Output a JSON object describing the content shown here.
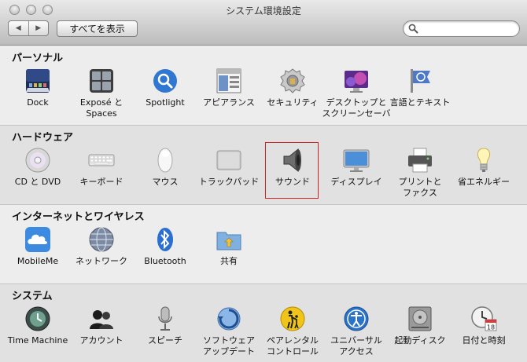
{
  "window": {
    "title": "システム環境設定"
  },
  "toolbar": {
    "back": "◀",
    "forward": "▶",
    "show_all": "すべてを表示"
  },
  "search": {
    "value": ""
  },
  "sections": [
    {
      "title": "パーソナル",
      "items": [
        {
          "label": "Dock",
          "icon": "dock-icon"
        },
        {
          "label": "Exposé と\nSpaces",
          "icon": "expose-spaces-icon"
        },
        {
          "label": "Spotlight",
          "icon": "spotlight-icon"
        },
        {
          "label": "アピアランス",
          "icon": "appearance-icon"
        },
        {
          "label": "セキュリティ",
          "icon": "security-icon"
        },
        {
          "label": "デスクトップと\nスクリーンセーバ",
          "icon": "desktop-screensaver-icon"
        },
        {
          "label": "言語とテキスト",
          "icon": "language-text-icon"
        }
      ]
    },
    {
      "title": "ハードウェア",
      "items": [
        {
          "label": "CD と DVD",
          "icon": "cd-dvd-icon"
        },
        {
          "label": "キーボード",
          "icon": "keyboard-icon"
        },
        {
          "label": "マウス",
          "icon": "mouse-icon"
        },
        {
          "label": "トラックパッド",
          "icon": "trackpad-icon"
        },
        {
          "label": "サウンド",
          "icon": "sound-icon",
          "selected": true
        },
        {
          "label": "ディスプレイ",
          "icon": "display-icon"
        },
        {
          "label": "プリントと\nファクス",
          "icon": "print-fax-icon"
        },
        {
          "label": "省エネルギー",
          "icon": "energy-saver-icon"
        }
      ]
    },
    {
      "title": "インターネットとワイヤレス",
      "items": [
        {
          "label": "MobileMe",
          "icon": "mobileme-icon"
        },
        {
          "label": "ネットワーク",
          "icon": "network-icon"
        },
        {
          "label": "Bluetooth",
          "icon": "bluetooth-icon"
        },
        {
          "label": "共有",
          "icon": "sharing-icon"
        }
      ]
    },
    {
      "title": "システム",
      "items": [
        {
          "label": "Time Machine",
          "icon": "time-machine-icon"
        },
        {
          "label": "アカウント",
          "icon": "accounts-icon"
        },
        {
          "label": "スピーチ",
          "icon": "speech-icon"
        },
        {
          "label": "ソフトウェア\nアップデート",
          "icon": "software-update-icon"
        },
        {
          "label": "ペアレンタル\nコントロール",
          "icon": "parental-controls-icon"
        },
        {
          "label": "ユニバーサル\nアクセス",
          "icon": "universal-access-icon"
        },
        {
          "label": "起動ディスク",
          "icon": "startup-disk-icon"
        },
        {
          "label": "日付と時刻",
          "icon": "date-time-icon"
        }
      ]
    }
  ],
  "calendar_badge": "18"
}
